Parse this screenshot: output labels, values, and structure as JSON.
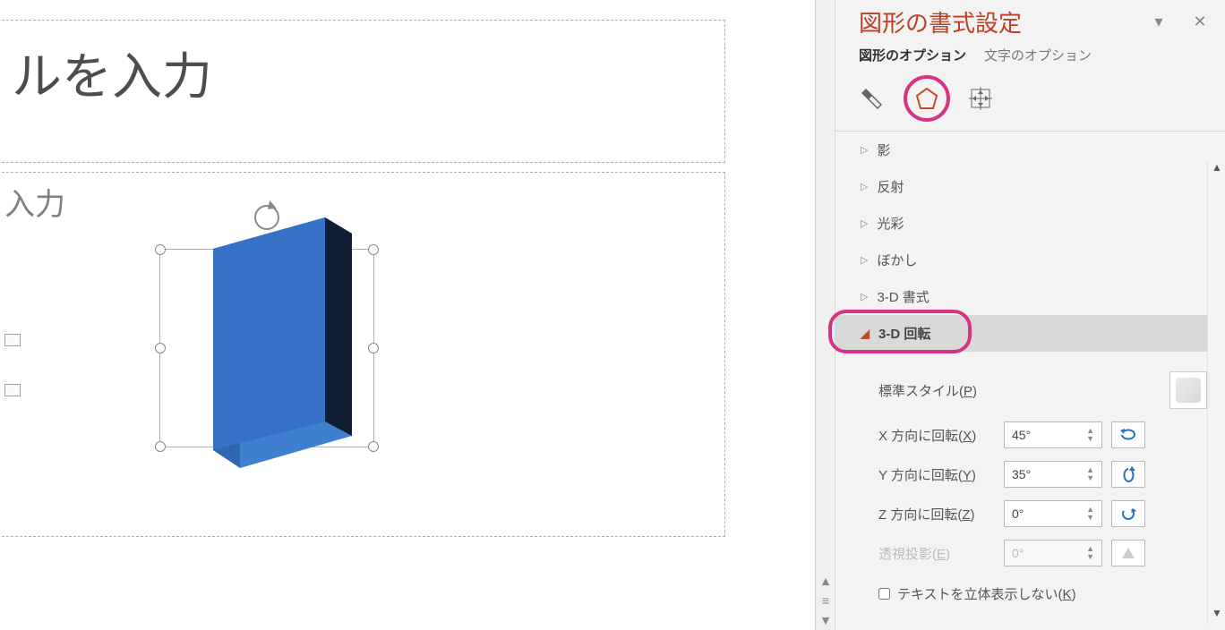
{
  "canvas": {
    "title_placeholder": "ルを入力",
    "subtitle_placeholder": "入力"
  },
  "panel": {
    "title": "図形の書式設定",
    "option_tabs": {
      "shape": "図形のオプション",
      "text": "文字のオプション"
    },
    "sections": {
      "shadow": "影",
      "reflection": "反射",
      "glow": "光彩",
      "soft_edges": "ぼかし",
      "format_3d": "3-D 書式",
      "rotation_3d": "3-D 回転"
    },
    "rotation_body": {
      "preset_label_pre": "標準スタイル(",
      "preset_key": "P",
      "preset_label_post": ")",
      "x_label_pre": "X 方向に回転(",
      "x_key": "X",
      "x_label_post": ")",
      "x_value": "45°",
      "y_label_pre": "Y 方向に回転(",
      "y_key": "Y",
      "y_label_post": ")",
      "y_value": "35°",
      "z_label_pre": "Z 方向に回転(",
      "z_key": "Z",
      "z_label_post": ")",
      "z_value": "0°",
      "persp_label_pre": "透視投影(",
      "persp_key": "E",
      "persp_label_post": ")",
      "persp_value": "0°",
      "keep_text_flat_pre": "テキストを立体表示しない(",
      "keep_text_flat_key": "K",
      "keep_text_flat_post": ")"
    }
  }
}
